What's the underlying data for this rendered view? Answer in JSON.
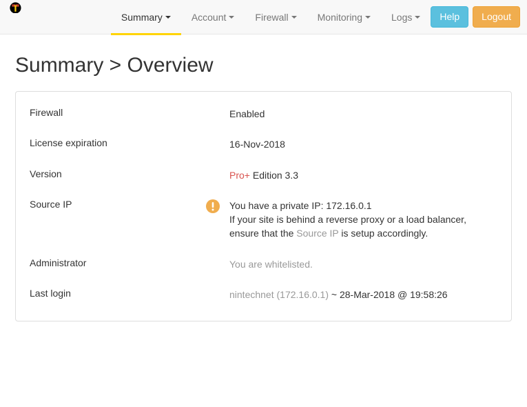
{
  "nav": {
    "items": [
      {
        "label": "Summary",
        "active": true
      },
      {
        "label": "Account",
        "active": false
      },
      {
        "label": "Firewall",
        "active": false
      },
      {
        "label": "Monitoring",
        "active": false
      },
      {
        "label": "Logs",
        "active": false
      }
    ],
    "help_label": "Help",
    "logout_label": "Logout"
  },
  "page": {
    "title": "Summary > Overview"
  },
  "summary": {
    "firewall": {
      "label": "Firewall",
      "value": "Enabled"
    },
    "license": {
      "label": "License expiration",
      "value": "16-Nov-2018"
    },
    "version": {
      "label": "Version",
      "pro": "Pro+",
      "edition": " Edition 3.3"
    },
    "sourceip": {
      "label": "Source IP",
      "line1": "You have a private IP: 172.16.0.1",
      "line2_a": "If your site is behind a reverse proxy or a load balancer, ensure that the ",
      "line2_link": "Source IP",
      "line2_b": " is setup accordingly."
    },
    "admin": {
      "label": "Administrator",
      "value": "You are whitelisted."
    },
    "lastlogin": {
      "label": "Last login",
      "user": "nintechnet (172.16.0.1)",
      "rest": " ~ 28-Mar-2018 @ 19:58:26"
    }
  }
}
